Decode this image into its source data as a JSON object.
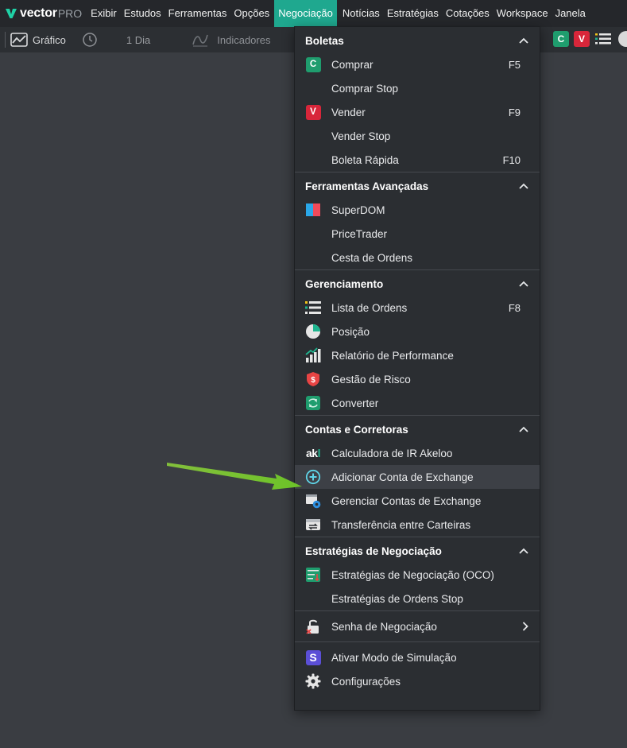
{
  "app": {
    "logo_text": "vector",
    "logo_suffix": "PRO",
    "menu": [
      "Exibir",
      "Estudos",
      "Ferramentas",
      "Opções",
      "Negociação",
      "Notícias",
      "Estratégias",
      "Cotações",
      "Workspace",
      "Janela"
    ],
    "active_menu": "Negociação"
  },
  "toolbar": {
    "chart_label": "Gráfico",
    "period_label": "1 Dia",
    "indicators_label": "Indicadores",
    "quick_buttons": [
      "C",
      "V"
    ]
  },
  "dropdown": {
    "sections": [
      {
        "title": "Boletas",
        "items": [
          {
            "label": "Comprar",
            "shortcut": "F5",
            "icon": "buy-c-badge-icon"
          },
          {
            "label": "Comprar Stop",
            "shortcut": "",
            "icon": ""
          },
          {
            "label": "Vender",
            "shortcut": "F9",
            "icon": "sell-v-badge-icon"
          },
          {
            "label": "Vender Stop",
            "shortcut": "",
            "icon": ""
          },
          {
            "label": "Boleta Rápida",
            "shortcut": "F10",
            "icon": ""
          }
        ]
      },
      {
        "title": "Ferramentas Avançadas",
        "items": [
          {
            "label": "SuperDOM",
            "shortcut": "",
            "icon": "superdom-icon"
          },
          {
            "label": "PriceTrader",
            "shortcut": "",
            "icon": ""
          },
          {
            "label": "Cesta de Ordens",
            "shortcut": "",
            "icon": ""
          }
        ]
      },
      {
        "title": "Gerenciamento",
        "items": [
          {
            "label": "Lista de Ordens",
            "shortcut": "F8",
            "icon": "order-list-icon"
          },
          {
            "label": "Posição",
            "shortcut": "",
            "icon": "pie-chart-icon"
          },
          {
            "label": "Relatório de Performance",
            "shortcut": "",
            "icon": "performance-bars-icon"
          },
          {
            "label": "Gestão de Risco",
            "shortcut": "",
            "icon": "risk-shield-icon"
          },
          {
            "label": "Converter",
            "shortcut": "",
            "icon": "convert-icon"
          }
        ]
      },
      {
        "title": "Contas e Corretoras",
        "items": [
          {
            "label": "Calculadora de IR Akeloo",
            "shortcut": "",
            "icon": "akeloo-logo-icon",
            "logo_text": "akl"
          },
          {
            "label": "Adicionar Conta de Exchange",
            "shortcut": "",
            "icon": "add-circle-icon",
            "highlighted": true
          },
          {
            "label": "Gerenciar Contas de Exchange",
            "shortcut": "",
            "icon": "manage-accounts-gear-icon"
          },
          {
            "label": "Transferência entre Carteiras",
            "shortcut": "",
            "icon": "wallet-transfer-icon"
          }
        ]
      },
      {
        "title": "Estratégias de Negociação",
        "items": [
          {
            "label": "Estratégias de Negociação (OCO)",
            "shortcut": "",
            "icon": "oco-strategy-icon"
          },
          {
            "label": "Estratégias de Ordens Stop",
            "shortcut": "",
            "icon": ""
          }
        ]
      },
      {
        "title": "",
        "items": [
          {
            "label": "Senha de Negociação",
            "shortcut": "",
            "icon": "unlock-icon",
            "submenu": true
          }
        ]
      },
      {
        "title": "",
        "items": [
          {
            "label": "Ativar Modo de Simulação",
            "shortcut": "",
            "icon": "simulation-s-icon",
            "badge_text": "S"
          },
          {
            "label": "Configurações",
            "shortcut": "",
            "icon": "gear-icon"
          }
        ]
      }
    ]
  },
  "colors": {
    "accent": "#1fa88f",
    "buy": "#1f9d6e",
    "sell": "#d8263a",
    "arrow": "#7ccf2e",
    "menu_bg": "#2b2e32",
    "canvas_bg": "#3a3d42"
  }
}
